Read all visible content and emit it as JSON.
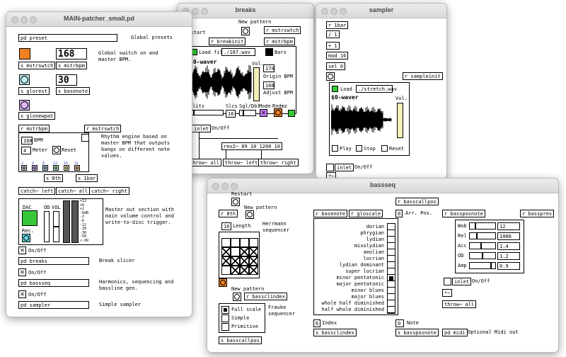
{
  "breaks": {
    "title": "breaks",
    "restart": "Restart",
    "new_pattern": "New pattern",
    "r_mstrswtch": "r mstrswtch",
    "r_breakinit": "r breakinit",
    "r_mstrbpm": "r mstrbpm",
    "load_file": "Load file",
    "file": "./187.wav",
    "bars": "Bars",
    "waver": "$0-waver",
    "vol": "Vol.",
    "origin_bpm_val": "174",
    "origin_bpm": "Origin BPM",
    "adjust_bpm_val": "168",
    "adjust_bpm": "Adjust BPM",
    "splits": "plits",
    "slcs": "Slcs",
    "sgl_dbl": "Sgl/Dbl",
    "mode": "Mode",
    "rndmz": "Rndmz",
    "slcs_val": "16",
    "inlet": "inlet",
    "on_off": "On/Off",
    "rev2": "rev2~ 89 10 1200 10",
    "throw_all": "throw~ all",
    "throw_left": "throw~ left",
    "throw_right": "throw~ right"
  },
  "sampler": {
    "title": "sampler",
    "r_1bar": "r 1bar",
    "div1": "/ 1",
    "plus1": "+ 1",
    "mod16": "mod 16",
    "sel0": "sel 0",
    "r_sampleinit": "r sampleinit",
    "load": "Load",
    "file": "./stretch.wav",
    "waver": "$0-waver",
    "vol": "Vol.",
    "play": "Play",
    "stop": "Stop",
    "reset": "Reset",
    "inlet": "inlet",
    "on_off": "On/Off",
    "star": "*~"
  },
  "main": {
    "title": "MAIN-patcher_small.pd",
    "pd_preset": "pd preset",
    "global_presets": "Global presets",
    "bpm_val": "168",
    "global_switch": "Global switch on and master BPM.",
    "s_mstrswtch": "s mstrswtch",
    "s_mstrbpm": "s mstrbpm",
    "basenote_val": "30",
    "s_glorest": "s glorest",
    "s_basenote": "s basenote",
    "s_glonewpat": "s glonewpat",
    "r_mstrbpm": "r mstrbpm",
    "r_mstrswtch": "r mstrswtch",
    "rhythm_desc": "Rhythm engine based on master BPM that outputs bangs on different note values.",
    "bpm_box": "168",
    "bpm_label": "BPM",
    "meter_val": "4",
    "meter": "Meter",
    "reset": "Reset",
    "note_values": [
      "2",
      "4",
      "8",
      "12",
      "16",
      "32"
    ],
    "s_8th": "s 8th",
    "s_1bar": "s 1bar",
    "catch_left": "catch~ left",
    "catch_all": "catch~ all",
    "catch_right": "catch~ right",
    "dac": "DAC",
    "od": "OD",
    "vol": "VOL",
    "rec": "Rec.",
    "meter_scale": [
      "+12",
      "+6",
      "+2",
      "-0dB",
      "-2",
      "-6",
      "-12",
      "-20",
      "-30",
      "-50",
      "<-99"
    ],
    "master_desc": "Master out section with main volume control and write-to-disc trigger.",
    "on_off": "On/Off",
    "pd_breaks": "pd breaks",
    "break_slicer": "Break slicer",
    "pd_bassseq": "pd bassseq",
    "bassseq_desc": "Harmonics, sequencing and bassline gen.",
    "pd_sampler": "pd sampler",
    "simple_sampler": "Simple sampler"
  },
  "bassseq": {
    "title": "bassseq",
    "restart": "Restart",
    "new_pattern": "New pattern",
    "r_8th": "r 8th",
    "length_val": "16",
    "length": "Length",
    "herrmann": "Herrmann sequencer",
    "new_pattern2": "New pattern",
    "r_bassclindex": "r bassclindex",
    "scales": [
      "Full scale",
      "Simple",
      "Primitive"
    ],
    "frauke": "Frauke sequencer",
    "s_basscallpos": "s basscallpos",
    "r_basenote": "r basenote",
    "r_gloscale": "r gloscale",
    "modes": [
      "dorian",
      "phrygian",
      "lydian",
      "mixolydian",
      "aeolian",
      "locrian",
      "lydian dominant",
      "super locrian",
      "minor pentatonic",
      "major pentatonic",
      "minor blues",
      "major blues",
      "whole half diminished",
      "half whole diminished"
    ],
    "r_basscallpos": "r basscallpos",
    "arr_val": "0",
    "arr_pos": "Arr. Pos.",
    "index_val": "6",
    "index": "Index",
    "note_val": "0",
    "note": "Note",
    "s_bassclindex": "s bassclindex",
    "s_bassposnote": "s bassposnote",
    "r_bassposnote": "r bassposnote",
    "r_basspres": "r basspres",
    "params": [
      {
        "name": "Wob",
        "value": "12",
        "level": 0.2
      },
      {
        "name": "Rel",
        "value": "1000",
        "level": 0.25
      },
      {
        "name": "Acc",
        "value": "1.4",
        "level": 0.45
      },
      {
        "name": "OD",
        "value": "1.2",
        "level": 0.5
      },
      {
        "name": "Amp",
        "value": "0.9",
        "level": 0.85
      }
    ],
    "inlet": "inlet",
    "on_off": "On/Off",
    "star": "*~",
    "throw_all": "throw~ all",
    "pd_midi": "pd midi",
    "midi_out": "Optional Midi out"
  }
}
